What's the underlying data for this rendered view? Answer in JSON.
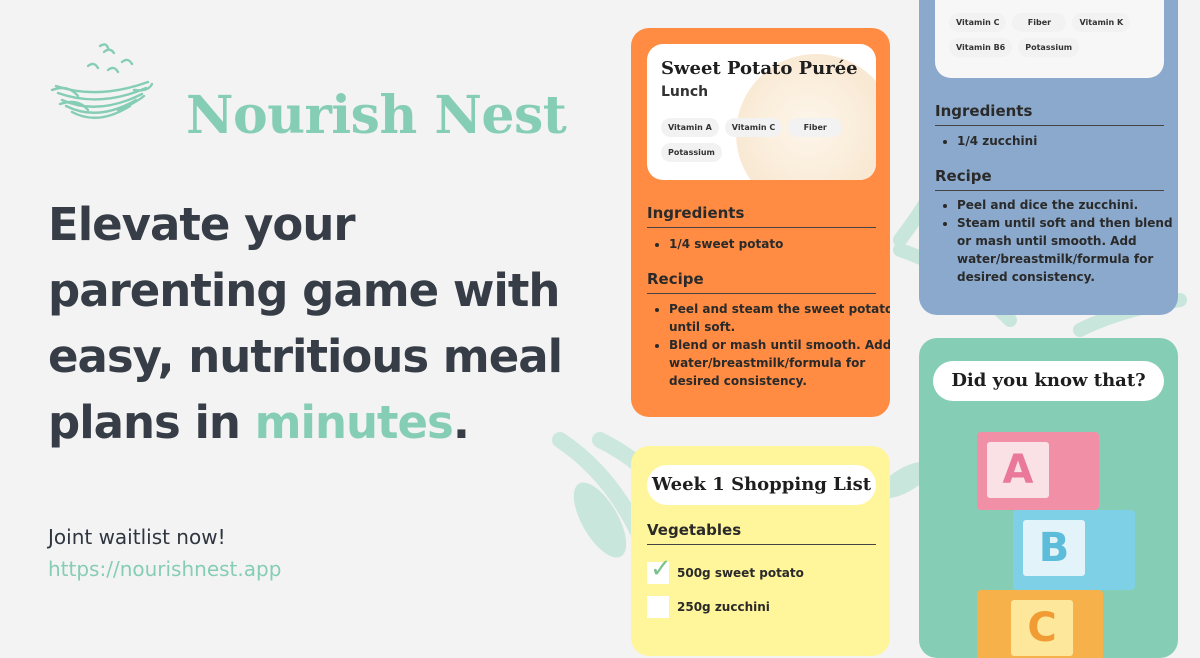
{
  "brand": {
    "name": "Nourish Nest",
    "logo_icon": "nest-birds-logo",
    "color": "#86cdb6"
  },
  "hero": {
    "headline_part1": "Elevate your parenting game with easy, nutritious meal plans in ",
    "headline_accent": "minutes",
    "headline_end": ".",
    "cta": "Joint waitlist now!",
    "url": "https://nourishnest.app"
  },
  "recipe_card": {
    "title": "Sweet Potato Purée",
    "meal": "Lunch",
    "tags": [
      "Vitamin A",
      "Vitamin C",
      "Fiber",
      "Potassium"
    ],
    "ingredients_heading": "Ingredients",
    "ingredients": [
      "1/4 sweet potato"
    ],
    "recipe_heading": "Recipe",
    "steps": [
      "Peel and steam the sweet potato until soft.",
      "Blend or mash until smooth. Add water/breastmilk/formula for desired consistency."
    ],
    "color": "#ff8c42"
  },
  "zucchini_card": {
    "tags": [
      "Vitamin C",
      "Fiber",
      "Vitamin K",
      "Vitamin B6",
      "Potassium"
    ],
    "ingredients_heading": "Ingredients",
    "ingredients": [
      "1/4 zucchini"
    ],
    "recipe_heading": "Recipe",
    "steps": [
      "Peel and dice the zucchini.",
      "Steam until soft and then blend or mash until smooth. Add water/breastmilk/formula for desired consistency."
    ],
    "color": "#8aa9cc"
  },
  "shopping_card": {
    "title": "Week 1 Shopping List",
    "section": "Vegetables",
    "items": [
      {
        "label": "500g sweet potato",
        "checked": true
      },
      {
        "label": "250g zucchini",
        "checked": false
      }
    ],
    "color": "#fff59a"
  },
  "fact_card": {
    "title": "Did you know that?",
    "blocks": [
      "A",
      "B",
      "C"
    ],
    "color": "#86cdb6"
  }
}
